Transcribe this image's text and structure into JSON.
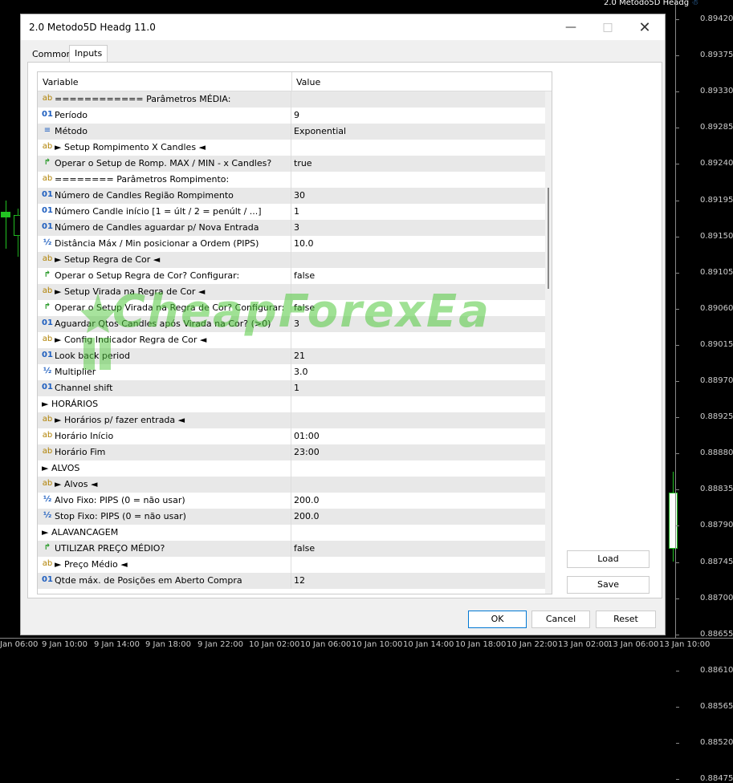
{
  "chart": {
    "symbol_title": "2.0 Metodo5D Headg",
    "prices": [
      "0.89420",
      "0.89375",
      "0.89330",
      "0.89285",
      "0.89240",
      "0.89195",
      "0.89150",
      "0.89105",
      "0.89060",
      "0.89015",
      "0.88970",
      "0.88925",
      "0.88880",
      "0.88835",
      "0.88790",
      "0.88745",
      "0.88700",
      "0.88655",
      "0.88610",
      "0.88565",
      "0.88520",
      "0.88475"
    ],
    "times": [
      "Jan 06:00",
      "9 Jan 10:00",
      "9 Jan 14:00",
      "9 Jan 18:00",
      "9 Jan 22:00",
      "10 Jan 02:00",
      "10 Jan 06:00",
      "10 Jan 10:00",
      "10 Jan 14:00",
      "10 Jan 18:00",
      "10 Jan 22:00",
      "13 Jan 02:00",
      "13 Jan 06:00",
      "13 Jan 10:00"
    ]
  },
  "dialog": {
    "title": "2.0 Metodo5D Headg 11.0",
    "minimize_icon": "minimize-icon",
    "maximize_icon": "maximize-icon",
    "close_icon": "close-icon",
    "tabs": [
      "Common",
      "Inputs"
    ],
    "active_tab": "Inputs",
    "grid": {
      "col_variable": "Variable",
      "col_value": "Value",
      "rows": [
        {
          "icon": "ab",
          "var": "============ Parâmetros MÉDIA:",
          "val": ""
        },
        {
          "icon": "01",
          "var": "Período",
          "val": "9"
        },
        {
          "icon": "list",
          "var": "Método",
          "val": "Exponential"
        },
        {
          "icon": "ab",
          "var": "► Setup Rompimento X Candles ◄",
          "val": ""
        },
        {
          "icon": "arrow",
          "var": "Operar o Setup de Romp. MAX / MIN - x Candles?",
          "val": "true"
        },
        {
          "icon": "ab",
          "var": "======== Parâmetros Rompimento:",
          "val": ""
        },
        {
          "icon": "01",
          "var": "Número de Candles Região Rompimento",
          "val": "30"
        },
        {
          "icon": "01",
          "var": "Número Candle início [1 = últ / 2 = penúlt / ...]",
          "val": "1"
        },
        {
          "icon": "01",
          "var": "Número de Candles aguardar p/ Nova Entrada",
          "val": "3"
        },
        {
          "icon": "half",
          "var": "Distância Máx / Min posicionar a Ordem (PIPS)",
          "val": "10.0"
        },
        {
          "icon": "ab",
          "var": "► Setup Regra de Cor ◄",
          "val": ""
        },
        {
          "icon": "arrow",
          "var": "Operar o Setup Regra de Cor? Configurar:",
          "val": "false"
        },
        {
          "icon": "ab",
          "var": "► Setup Virada na Regra de Cor ◄",
          "val": ""
        },
        {
          "icon": "arrow",
          "var": "Operar o Setup Virada na Regra de Cor? Configurar:",
          "val": "false"
        },
        {
          "icon": "01",
          "var": "Aguardar Qtos Candles após Virada na Cor? (>0)",
          "val": "3"
        },
        {
          "icon": "ab",
          "var": "► Config Indicador Regra de Cor ◄",
          "val": ""
        },
        {
          "icon": "01",
          "var": "Look back period",
          "val": "21"
        },
        {
          "icon": "half",
          "var": "Multiplier",
          "val": "3.0"
        },
        {
          "icon": "01",
          "var": "Channel shift",
          "val": "1"
        },
        {
          "icon": "none",
          "var": "► HORÁRIOS",
          "val": ""
        },
        {
          "icon": "ab",
          "var": "► Horários p/ fazer entrada ◄",
          "val": ""
        },
        {
          "icon": "ab",
          "var": "Horário Início",
          "val": "01:00"
        },
        {
          "icon": "ab",
          "var": "Horário Fim",
          "val": "23:00"
        },
        {
          "icon": "none",
          "var": "► ALVOS",
          "val": ""
        },
        {
          "icon": "ab",
          "var": "► Alvos ◄",
          "val": ""
        },
        {
          "icon": "half",
          "var": "Alvo Fixo: PIPS (0 = não usar)",
          "val": "200.0"
        },
        {
          "icon": "half",
          "var": "Stop Fixo: PIPS (0 = não usar)",
          "val": "200.0"
        },
        {
          "icon": "none",
          "var": "► ALAVANCAGEM",
          "val": ""
        },
        {
          "icon": "arrow",
          "var": "UTILIZAR PREÇO MÉDIO?",
          "val": "false"
        },
        {
          "icon": "ab",
          "var": "► Preço Médio ◄",
          "val": ""
        },
        {
          "icon": "01",
          "var": "Qtde máx. de Posições em Aberto Compra",
          "val": "12"
        }
      ]
    },
    "load_label": "Load",
    "save_label": "Save",
    "ok_label": "OK",
    "cancel_label": "Cancel",
    "reset_label": "Reset"
  },
  "watermark": "CheapForexEa"
}
